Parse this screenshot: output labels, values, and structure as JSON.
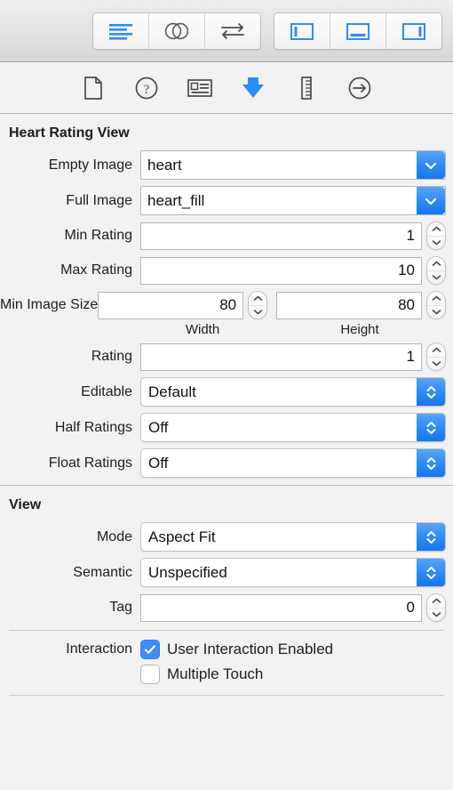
{
  "toolbar": {
    "left_group": [
      {
        "name": "align-left-icon",
        "label": "Show Document Outline",
        "selected": true
      },
      {
        "name": "venn-circles-icon",
        "label": "Show Intersection",
        "selected": false
      },
      {
        "name": "swap-arrows-icon",
        "label": "Swap Preview",
        "selected": false
      }
    ],
    "right_group": [
      {
        "name": "left-panel-icon",
        "label": "Navigator Panel",
        "selected": true
      },
      {
        "name": "bottom-panel-icon",
        "label": "Debug Panel",
        "selected": true
      },
      {
        "name": "right-panel-icon",
        "label": "Utilities Panel",
        "selected": true
      }
    ]
  },
  "inspector_tabs": [
    {
      "name": "file-inspector-icon",
      "label": "File Inspector",
      "selected": false
    },
    {
      "name": "quick-help-icon",
      "label": "Quick Help Inspector",
      "selected": false
    },
    {
      "name": "identity-inspector-icon",
      "label": "Identity Inspector",
      "selected": false
    },
    {
      "name": "attributes-inspector-icon",
      "label": "Attributes Inspector",
      "selected": true
    },
    {
      "name": "size-inspector-icon",
      "label": "Size Inspector",
      "selected": false
    },
    {
      "name": "connections-inspector-icon",
      "label": "Connections Inspector",
      "selected": false
    }
  ],
  "heart_rating_section": {
    "title": "Heart Rating View",
    "empty_image": {
      "label": "Empty Image",
      "value": "heart"
    },
    "full_image": {
      "label": "Full Image",
      "value": "heart_fill"
    },
    "min_rating": {
      "label": "Min Rating",
      "value": "1"
    },
    "max_rating": {
      "label": "Max Rating",
      "value": "10"
    },
    "min_image_size": {
      "label": "Min Image Size",
      "width_value": "80",
      "height_value": "80",
      "width_sublabel": "Width",
      "height_sublabel": "Height"
    },
    "rating": {
      "label": "Rating",
      "value": "1"
    },
    "editable": {
      "label": "Editable",
      "value": "Default"
    },
    "half_ratings": {
      "label": "Half Ratings",
      "value": "Off"
    },
    "float_ratings": {
      "label": "Float Ratings",
      "value": "Off"
    }
  },
  "view_section": {
    "title": "View",
    "mode": {
      "label": "Mode",
      "value": "Aspect Fit"
    },
    "semantic": {
      "label": "Semantic",
      "value": "Unspecified"
    },
    "tag": {
      "label": "Tag",
      "value": "0"
    },
    "interaction": {
      "label": "Interaction",
      "user_interaction_enabled": {
        "text": "User Interaction Enabled",
        "checked": true
      },
      "multiple_touch": {
        "text": "Multiple Touch",
        "checked": false
      }
    }
  },
  "colors": {
    "accent_blue": "#2f8cf4",
    "checkbox_blue": "#3d8ef5",
    "panel_background": "#f2f2f2",
    "toolbar_background": "#e4e4e4",
    "divider": "#b4b4b4"
  }
}
